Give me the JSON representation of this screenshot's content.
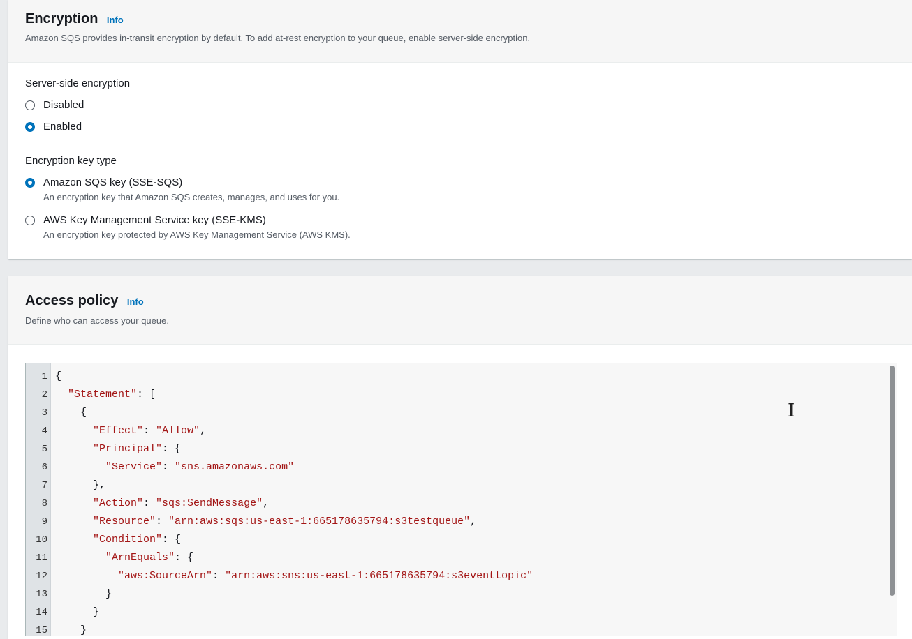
{
  "encryption": {
    "title": "Encryption",
    "info": "Info",
    "description": "Amazon SQS provides in-transit encryption by default. To add at-rest encryption to your queue, enable server-side encryption.",
    "sse_label": "Server-side encryption",
    "sse_options": [
      {
        "label": "Disabled",
        "selected": false
      },
      {
        "label": "Enabled",
        "selected": true
      }
    ],
    "key_type_label": "Encryption key type",
    "key_type_options": [
      {
        "label": "Amazon SQS key (SSE-SQS)",
        "description": "An encryption key that Amazon SQS creates, manages, and uses for you.",
        "selected": true
      },
      {
        "label": "AWS Key Management Service key (SSE-KMS)",
        "description": "An encryption key protected by AWS Key Management Service (AWS KMS).",
        "selected": false
      }
    ]
  },
  "access_policy": {
    "title": "Access policy",
    "info": "Info",
    "description": "Define who can access your queue.",
    "code_lines": [
      "{",
      "  \"Statement\": [",
      "    {",
      "      \"Effect\": \"Allow\",",
      "      \"Principal\": {",
      "        \"Service\": \"sns.amazonaws.com\"",
      "      },",
      "      \"Action\": \"sqs:SendMessage\",",
      "      \"Resource\": \"arn:aws:sqs:us-east-1:665178635794:s3testqueue\",",
      "      \"Condition\": {",
      "        \"ArnEquals\": {",
      "          \"aws:SourceArn\": \"arn:aws:sns:us-east-1:665178635794:s3eventtopic\"",
      "        }",
      "      }",
      "    }"
    ]
  },
  "colors": {
    "link": "#0073bb",
    "radio_selected": "#0073bb",
    "json_string": "#a31515"
  },
  "icons": [
    "radio-button",
    "text-cursor-icon"
  ]
}
